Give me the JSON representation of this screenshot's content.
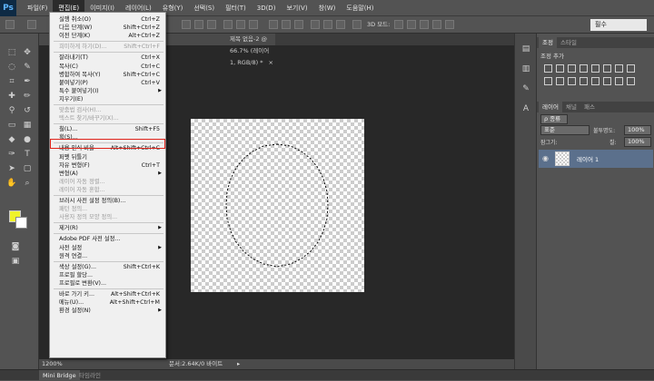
{
  "app": {
    "logo": "Ps",
    "menus": [
      "파일(F)",
      "편집(E)",
      "이미지(I)",
      "레이어(L)",
      "유형(Y)",
      "선택(S)",
      "필터(T)",
      "3D(D)",
      "보기(V)",
      "창(W)",
      "도움말(H)"
    ],
    "active_menu_index": 1
  },
  "options": {
    "mode_label": "3D 모드:",
    "workspace": "필수"
  },
  "document": {
    "tab_title": "제목 없음-2 @ 66.7% (레이어 1, RGB/8) *",
    "zoom": "1200%",
    "doc_info": "문서:2.64K/0 바이트"
  },
  "edit_menu": [
    {
      "label": "실행 취소(O)",
      "shortcut": "Ctrl+Z",
      "disabled": false
    },
    {
      "label": "다음 단계(W)",
      "shortcut": "Shift+Ctrl+Z",
      "disabled": false
    },
    {
      "label": "이전 단계(K)",
      "shortcut": "Alt+Ctrl+Z",
      "disabled": false
    },
    {
      "sep": true
    },
    {
      "label": "희미하게 하기(D)...",
      "shortcut": "Shift+Ctrl+F",
      "disabled": true
    },
    {
      "sep": true
    },
    {
      "label": "잘라내기(T)",
      "shortcut": "Ctrl+X",
      "disabled": false
    },
    {
      "label": "복사(C)",
      "shortcut": "Ctrl+C",
      "disabled": false
    },
    {
      "label": "병합하여 복사(Y)",
      "shortcut": "Shift+Ctrl+C",
      "disabled": false
    },
    {
      "label": "붙여넣기(P)",
      "shortcut": "Ctrl+V",
      "disabled": false
    },
    {
      "label": "특수 붙여넣기(I)",
      "shortcut": "",
      "submenu": true,
      "disabled": false
    },
    {
      "label": "지우기(E)",
      "shortcut": "",
      "disabled": false
    },
    {
      "sep": true
    },
    {
      "label": "맞춤법 검사(H)...",
      "shortcut": "",
      "disabled": true
    },
    {
      "label": "텍스트 찾기/바꾸기(X)...",
      "shortcut": "",
      "disabled": true
    },
    {
      "sep": true
    },
    {
      "label": "칠(L)...",
      "shortcut": "Shift+F5",
      "disabled": false,
      "highlight": true
    },
    {
      "label": "획(S)...",
      "shortcut": "",
      "disabled": false
    },
    {
      "sep": true
    },
    {
      "label": "내용 인식 비율",
      "shortcut": "Alt+Shift+Ctrl+C",
      "disabled": false
    },
    {
      "label": "퍼펫 뒤틀기",
      "shortcut": "",
      "disabled": false
    },
    {
      "label": "자유 변형(F)",
      "shortcut": "Ctrl+T",
      "disabled": false
    },
    {
      "label": "변형(A)",
      "shortcut": "",
      "submenu": true,
      "disabled": false
    },
    {
      "label": "레이어 자동 정렬...",
      "shortcut": "",
      "disabled": true
    },
    {
      "label": "레이어 자동 혼합...",
      "shortcut": "",
      "disabled": true
    },
    {
      "sep": true
    },
    {
      "label": "브러시 사전 설정 정의(B)...",
      "shortcut": "",
      "disabled": false
    },
    {
      "label": "패턴 정의...",
      "shortcut": "",
      "disabled": true
    },
    {
      "label": "사용자 정의 모양 정의...",
      "shortcut": "",
      "disabled": true
    },
    {
      "sep": true
    },
    {
      "label": "제거(R)",
      "shortcut": "",
      "submenu": true,
      "disabled": false
    },
    {
      "sep": true
    },
    {
      "label": "Adobe PDF 사전 설정...",
      "shortcut": "",
      "disabled": false
    },
    {
      "label": "사전 설정",
      "shortcut": "",
      "submenu": true,
      "disabled": false
    },
    {
      "label": "원격 연결...",
      "shortcut": "",
      "disabled": false
    },
    {
      "sep": true
    },
    {
      "label": "색상 설정(G)...",
      "shortcut": "Shift+Ctrl+K",
      "disabled": false
    },
    {
      "label": "프로필 할당...",
      "shortcut": "",
      "disabled": false
    },
    {
      "label": "프로필로 변환(V)...",
      "shortcut": "",
      "disabled": false
    },
    {
      "sep": true
    },
    {
      "label": "바로 가기 키...",
      "shortcut": "Alt+Shift+Ctrl+K",
      "disabled": false
    },
    {
      "label": "메뉴(U)...",
      "shortcut": "Alt+Shift+Ctrl+M",
      "disabled": false
    },
    {
      "label": "환경 설정(N)",
      "shortcut": "",
      "submenu": true,
      "disabled": false
    }
  ],
  "panels": {
    "adjust_tabs": [
      "조정",
      "스타일"
    ],
    "adjust_title": "조정 추가",
    "layer_tabs": [
      "레이어",
      "채널",
      "패스"
    ],
    "kind_filter": "ρ 종류",
    "blend_mode": "표준",
    "opacity_label": "불투명도:",
    "opacity_value": "100%",
    "lock_label": "잠그기:",
    "fill_label": "칠:",
    "fill_value": "100%",
    "layer_name": "레이어 1"
  },
  "bottom_tabs": [
    "Mini Bridge",
    "타임라인"
  ]
}
